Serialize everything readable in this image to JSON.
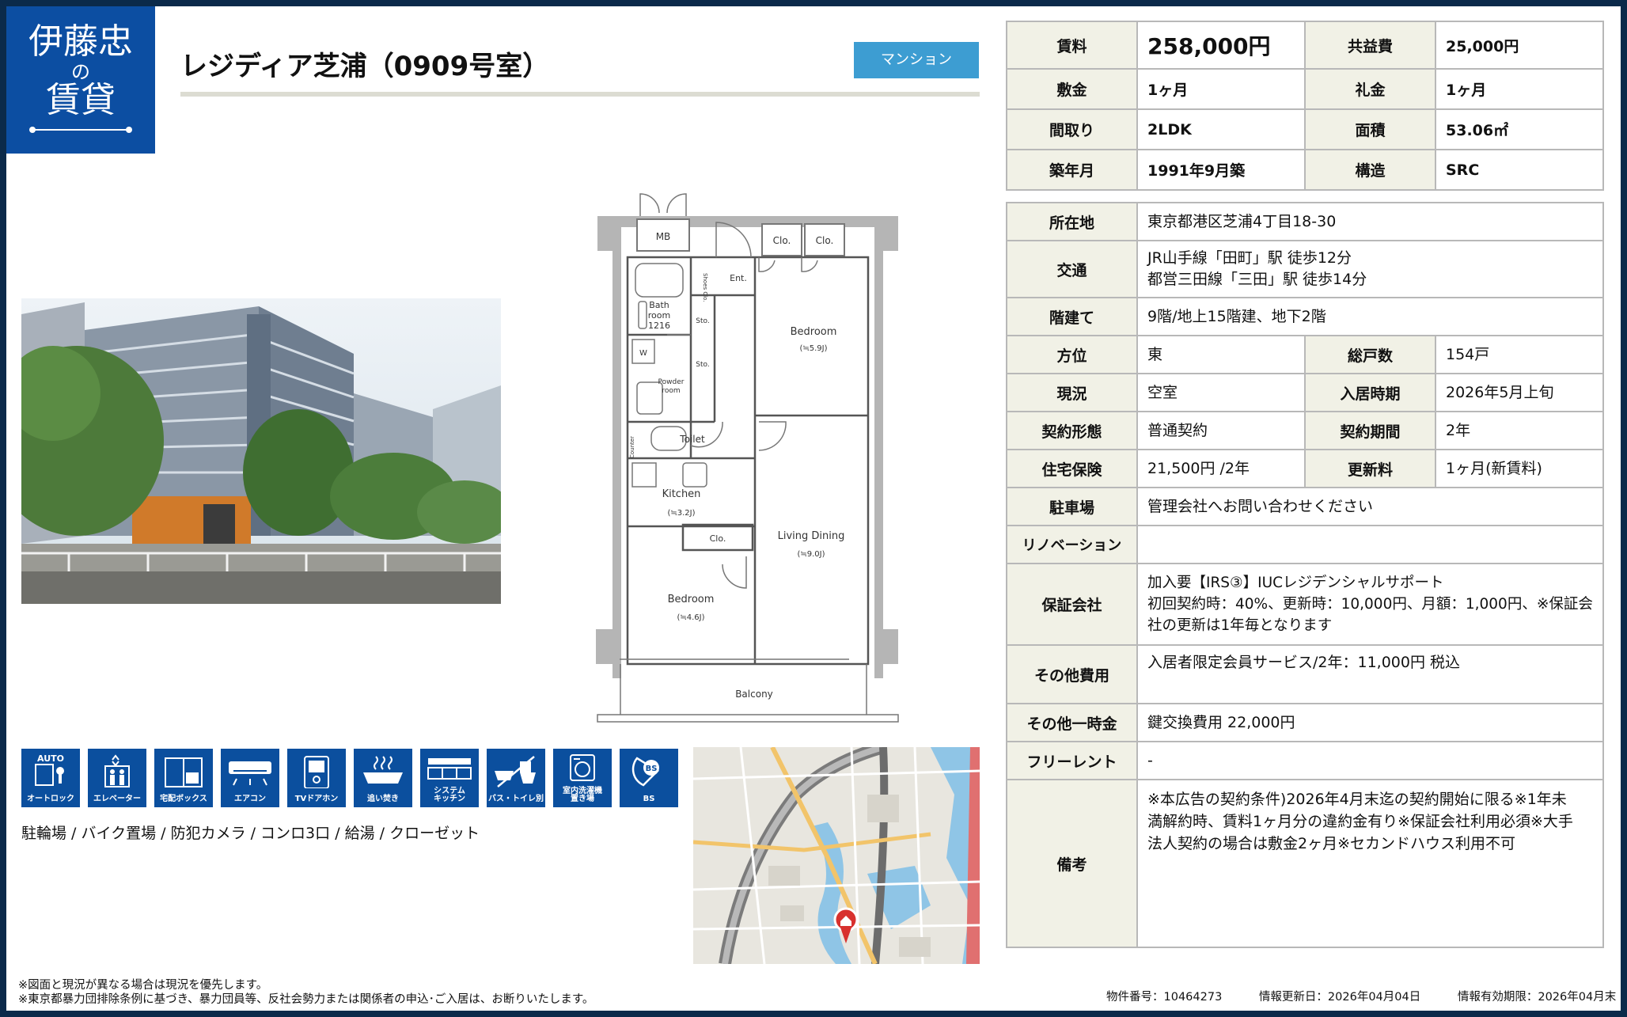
{
  "brand": {
    "line1": "伊藤忠",
    "line2": "の",
    "line3": "賃貸"
  },
  "property": {
    "title": "レジディア芝浦（0909号室）",
    "type_badge": "マンション"
  },
  "floorplan": {
    "rooms": {
      "mb": "MB",
      "clo1": "Clo.",
      "clo2": "Clo.",
      "ent": "Ent.",
      "shoes": "Shoes Clo.",
      "bath": "Bath",
      "bath2": "room",
      "bath3": "1216",
      "sto1": "Sto.",
      "sto2": "Sto.",
      "w": "W",
      "powder": "Powder",
      "powder2": "room",
      "counter": "Counter",
      "toilet": "Toilet",
      "bedroom1": "Bedroom",
      "bedroom1_size": "(≒5.9J)",
      "kitchen": "Kitchen",
      "kitchen_size": "(≒3.2J)",
      "clo3": "Clo.",
      "living": "Living Dining",
      "living_size": "(≒9.0J)",
      "bedroom2": "Bedroom",
      "bedroom2_size": "(≒4.6J)",
      "balcony": "Balcony"
    }
  },
  "equipment_icons": [
    {
      "name": "auto-lock-icon",
      "label": "オートロック",
      "glyph": "AUTO"
    },
    {
      "name": "elevator-icon",
      "label": "エレベーター"
    },
    {
      "name": "delivery-box-icon",
      "label": "宅配ボックス"
    },
    {
      "name": "air-conditioner-icon",
      "label": "エアコン"
    },
    {
      "name": "tv-intercom-icon",
      "label": "TVドアホン"
    },
    {
      "name": "reheat-bath-icon",
      "label": "追い焚き"
    },
    {
      "name": "system-kitchen-icon",
      "label": "システム",
      "label2": "キッチン"
    },
    {
      "name": "separate-bath-toilet-icon",
      "label": "バス・トイレ別"
    },
    {
      "name": "indoor-washer-icon",
      "label": "室内洗濯機",
      "label2": "置き場"
    },
    {
      "name": "bs-antenna-icon",
      "label": "BS",
      "glyph": "BS"
    }
  ],
  "facilities": "駐輪場 / バイク置場 / 防犯カメラ / コンロ3口 / 給湯 / クローゼット",
  "summary": {
    "rent_label": "賃料",
    "rent": "258,000円",
    "common_fee_label": "共益費",
    "common_fee": "25,000円",
    "deposit_label": "敷金",
    "deposit": "1ヶ月",
    "key_money_label": "礼金",
    "key_money": "1ヶ月",
    "layout_label": "間取り",
    "layout": "2LDK",
    "area_label": "面積",
    "area": "53.06㎡",
    "built_label": "築年月",
    "built": "1991年9月築",
    "structure_label": "構造",
    "structure": "SRC"
  },
  "details": {
    "address_label": "所在地",
    "address": "東京都港区芝浦4丁目18-30",
    "transit_label": "交通",
    "transit1": "JR山手線「田町」駅 徒歩12分",
    "transit2": "都営三田線「三田」駅 徒歩14分",
    "floor_label": "階建て",
    "floor": "9階/地上15階建、地下2階",
    "direction_label": "方位",
    "direction": "東",
    "units_label": "総戸数",
    "units": "154戸",
    "status_label": "現況",
    "status": "空室",
    "move_in_label": "入居時期",
    "move_in": "2026年5月上旬",
    "contract_type_label": "契約形態",
    "contract_type": "普通契約",
    "contract_term_label": "契約期間",
    "contract_term": "2年",
    "insurance_label": "住宅保険",
    "insurance": "21,500円 /2年",
    "renewal_label": "更新料",
    "renewal": "1ヶ月(新賃料)",
    "parking_label": "駐車場",
    "parking": "管理会社へお問い合わせください",
    "renovation_label": "リノベーション",
    "renovation": "",
    "guarantor_label": "保証会社",
    "guarantor1": "加入要【IRS③】IUCレジデンシャルサポート",
    "guarantor2": "初回契約時：40%、更新時：10,000円、月額：1,000円、※保証会",
    "guarantor3": "社の更新は1年毎となります",
    "other_fees_label": "その他費用",
    "other_fees": "入居者限定会員サービス/2年：11,000円 税込",
    "one_time_label": "その他一時金",
    "one_time": "鍵交換費用 22,000円",
    "free_rent_label": "フリーレント",
    "free_rent": "-",
    "remarks_label": "備考",
    "remarks1": "※本広告の契約条件)2026年4月末迄の契約開始に限る※1年未",
    "remarks2": "満解約時、賃料1ヶ月分の違約金有り※保証会社利用必須※大手",
    "remarks3": "法人契約の場合は敷金2ヶ月※セカンドハウス利用不可"
  },
  "footer": {
    "note1": "※図面と現況が異なる場合は現況を優先します。",
    "note2": "※東京都暴力団排除条例に基づき、暴力団員等、反社会勢力または関係者の申込･ご入居は、お断りいたします。",
    "property_no": "物件番号：10464273",
    "updated": "情報更新日：2026年04月04日",
    "valid_until": "情報有効期限：2026年04月末"
  },
  "colors": {
    "brand_blue": "#0c4ea2",
    "badge_blue": "#3d9dd2",
    "header_cell": "#f1f1e6"
  }
}
